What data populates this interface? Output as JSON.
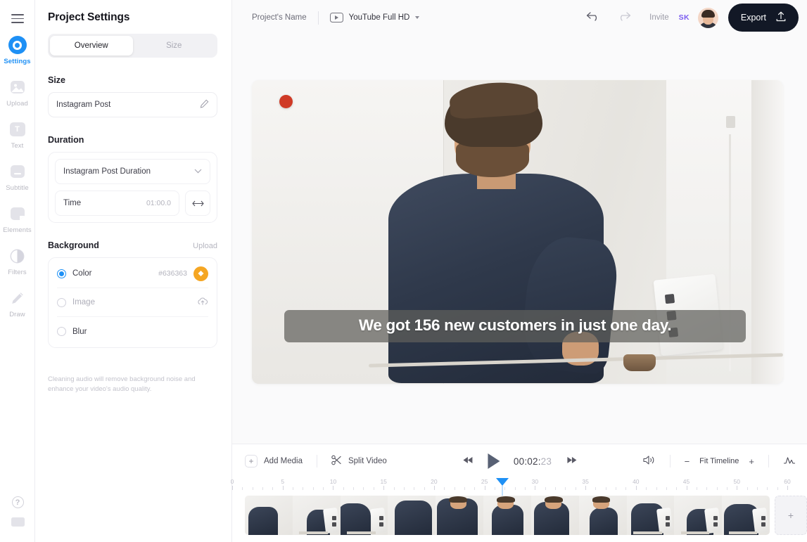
{
  "rail": {
    "menu_icon": "hamburger-icon",
    "items": [
      {
        "label": "Settings",
        "icon": "settings-ring-icon",
        "active": true
      },
      {
        "label": "Upload",
        "icon": "image-upload-icon",
        "active": false
      },
      {
        "label": "Text",
        "icon": "text-t-icon",
        "active": false
      },
      {
        "label": "Subtitle",
        "icon": "subtitle-icon",
        "active": false
      },
      {
        "label": "Elements",
        "icon": "elements-icon",
        "active": false
      },
      {
        "label": "Filters",
        "icon": "filters-contrast-icon",
        "active": false
      },
      {
        "label": "Draw",
        "icon": "pencil-draw-icon",
        "active": false
      }
    ],
    "bottom": [
      {
        "icon": "help-question-icon",
        "glyph": "?"
      },
      {
        "icon": "keyboard-shortcuts-icon",
        "glyph": ""
      }
    ]
  },
  "panel": {
    "title": "Project Settings",
    "tabs": [
      {
        "label": "Overview",
        "active": true
      },
      {
        "label": "Size",
        "active": false
      }
    ],
    "size": {
      "section_label": "Size",
      "value": "Instagram Post",
      "edit_icon": "pencil-edit-icon"
    },
    "duration": {
      "section_label": "Duration",
      "preset": "Instagram Post Duration",
      "dropdown_icon": "chevron-down-icon",
      "time_label": "Time",
      "time_value": "01:00.0",
      "resize_icon": "left-right-arrow-icon"
    },
    "background": {
      "section_label": "Background",
      "upload_link": "Upload",
      "options": [
        {
          "label": "Color",
          "selected": true,
          "hex": "#636363",
          "swatch_color": "#f5a623",
          "swatch_icon": "color-picker-icon"
        },
        {
          "label": "Image",
          "selected": false,
          "hex": "",
          "trailing_icon": "cloud-upload-icon"
        },
        {
          "label": "Blur",
          "selected": false,
          "hex": "",
          "trailing_icon": ""
        }
      ]
    },
    "note": "Cleaning audio will remove background noise and enhance your video's audio quality."
  },
  "topbar": {
    "project_name": "Project's Name",
    "preset_icon": "video-play-box-icon",
    "preset_label": "YouTube Full HD",
    "preset_caret": "chevron-down-icon",
    "undo_icon": "undo-arrow-icon",
    "redo_icon": "redo-arrow-icon",
    "invite_label": "Invite",
    "collaborator_initials": "SK",
    "collaborator_color": "#7b5cf0",
    "avatar_name": "user-avatar",
    "export_label": "Export",
    "export_icon": "upload-arrow-icon",
    "export_bg": "#121826"
  },
  "preview": {
    "subtitle_text": "We got 156 new customers in just one day.",
    "subtitle_bg": "rgba(96,96,92,0.72)",
    "marker_icon": "red-dot-marker"
  },
  "timeline": {
    "add_media_label": "Add Media",
    "add_media_icon": "plus-icon",
    "split_video_label": "Split Video",
    "split_icon": "scissors-icon",
    "skip_back_icon": "skip-backward-icon",
    "play_icon": "play-triangle-icon",
    "skip_fwd_icon": "skip-forward-icon",
    "timecode": "00:02:",
    "timecode_ms": "23",
    "volume_icon": "speaker-volume-icon",
    "zoom_out_icon": "minus-icon",
    "fit_label": "Fit Timeline",
    "zoom_in_icon": "plus-icon",
    "waveform_icon": "audio-waveform-icon",
    "ruler_labels": [
      "0",
      "5",
      "10",
      "15",
      "20",
      "25",
      "30",
      "35",
      "40",
      "45",
      "50",
      "60"
    ],
    "playhead_label": "playhead",
    "add_clip_icon": "plus-icon",
    "clip_count": 11
  }
}
